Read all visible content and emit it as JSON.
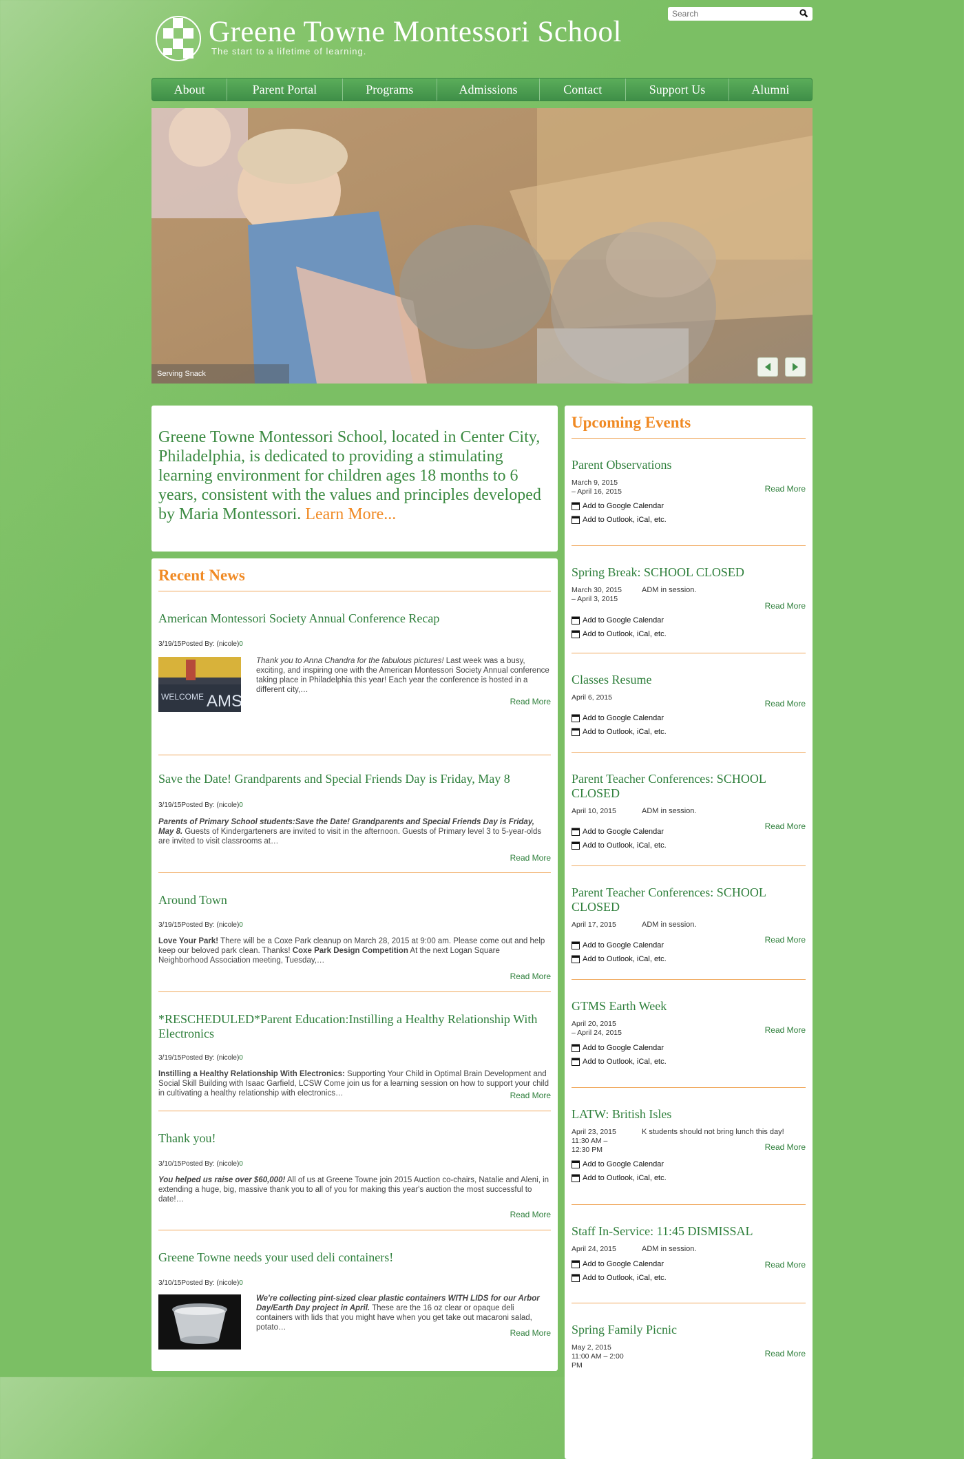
{
  "header": {
    "title": "Greene Towne Montessori School",
    "tagline": "The start to a lifetime of learning.",
    "search_placeholder": "Search"
  },
  "nav": [
    "About",
    "Parent Portal",
    "Programs",
    "Admissions",
    "Contact",
    "Support Us",
    "Alumni"
  ],
  "slider": {
    "caption": "Serving Snack"
  },
  "intro": {
    "text": "Greene Towne Montessori School, located in Center City, Philadelphia, is dedicated to providing a stimulating learning environment for children ages 18 months to 6 years, consistent with the values and principles developed by Maria Montessori. ",
    "link": "Learn More..."
  },
  "news": {
    "title": "Recent News",
    "read_more": "Read More",
    "items": [
      {
        "title": "American Montessori Society Annual Conference Recap",
        "meta": "3/19/15Posted By: (nicole)",
        "count": "0",
        "lead": "Thank you to Anna Chandra for the fabulous pictures!",
        "body": " Last week was a busy, exciting, and inspiring one with the American Montessori Society Annual conference taking place in Philadelphia this year! Each year the conference is hosted in a different city,…"
      },
      {
        "title": "Save the Date! Grandparents and Special Friends Day is Friday, May 8",
        "meta": "3/19/15Posted By: (nicole)",
        "count": "0",
        "lead": "Parents of Primary School students:Save the Date! Grandparents and Special Friends Day is Friday, May 8.",
        "body": "   Guests of Kindergarteners are invited to visit in the afternoon. Guests of Primary level 3 to 5-year-olds are invited to visit classrooms at…"
      },
      {
        "title": "Around Town",
        "meta": "3/19/15Posted By: (nicole)",
        "count": "0",
        "lead": "Love Your Park!",
        "body": " There will be a Coxe Park cleanup on March 28, 2015 at 9:00 am. Please come out and help keep our beloved park clean. Thanks! ",
        "lead2": "Coxe Park Design Competition",
        "body2": " At the next Logan Square Neighborhood Association meeting, Tuesday,…"
      },
      {
        "title": "*RESCHEDULED*Parent Education:Instilling a Healthy Relationship With Electronics",
        "meta": "3/19/15Posted By: (nicole)",
        "count": "0",
        "lead": "Instilling a Healthy Relationship With Electronics:",
        "body": " Supporting Your Child in Optimal Brain Development and Social Skill Building with Isaac Garfield, LCSW Come join us for a learning session on how to support your child in cultivating a healthy relationship with electronics…"
      },
      {
        "title": "Thank you!",
        "meta": "3/10/15Posted By: (nicole)",
        "count": "0",
        "lead": "You helped us raise over $60,000!",
        "body": " All of us at Greene Towne join 2015 Auction co-chairs, Natalie and Aleni, in extending a huge, big, massive thank you to all of you for making this year's auction the most successful to date!…"
      },
      {
        "title": "Greene Towne needs your used deli containers!",
        "meta": "3/10/15Posted By: (nicole)",
        "count": "0",
        "lead": "We're collecting pint-sized clear plastic containers WITH LIDS for our Arbor Day/Earth Day project in April.",
        "body": "  These are the 16 oz clear or opaque deli containers with lids that you might have when you get take out macaroni salad, potato…"
      }
    ]
  },
  "events": {
    "title": "Upcoming Events",
    "read_more": "Read More",
    "google": "Add to Google Calendar",
    "outlook": "Add to Outlook, iCal, etc.",
    "items": [
      {
        "title": "Parent Observations",
        "date1": "March 9, 2015",
        "date2": "– April 16, 2015",
        "date3": "",
        "note": ""
      },
      {
        "title": "Spring Break: SCHOOL CLOSED",
        "date1": "March 30, 2015",
        "date2": "– April 3, 2015",
        "date3": "",
        "note": "ADM in session."
      },
      {
        "title": "Classes Resume",
        "date1": "April 6, 2015",
        "date2": "",
        "date3": "",
        "note": ""
      },
      {
        "title": "Parent Teacher Conferences: SCHOOL CLOSED",
        "date1": "April 10, 2015",
        "date2": "",
        "date3": "",
        "note": "ADM in session."
      },
      {
        "title": "Parent Teacher Conferences: SCHOOL CLOSED",
        "date1": "April 17, 2015",
        "date2": "",
        "date3": "",
        "note": "ADM in session."
      },
      {
        "title": "GTMS Earth Week",
        "date1": "April 20, 2015",
        "date2": "– April 24, 2015",
        "date3": "",
        "note": ""
      },
      {
        "title": "LATW: British Isles",
        "date1": "April 23, 2015",
        "date2": "11:30 AM –",
        "date3": "12:30 PM",
        "note": "K students should not bring lunch this day!"
      },
      {
        "title": "Staff In-Service: 11:45 DISMISSAL",
        "date1": "April 24, 2015",
        "date2": "",
        "date3": "",
        "note": "ADM in session."
      },
      {
        "title": "Spring Family Picnic",
        "date1": "May 2, 2015",
        "date2": "11:00 AM – 2:00",
        "date3": "PM",
        "note": ""
      }
    ]
  },
  "colors": {
    "background": "#7bbf64",
    "accent_orange": "#f08a24",
    "link_green": "#2e7f3b",
    "nav_green": "#4a9e50"
  }
}
